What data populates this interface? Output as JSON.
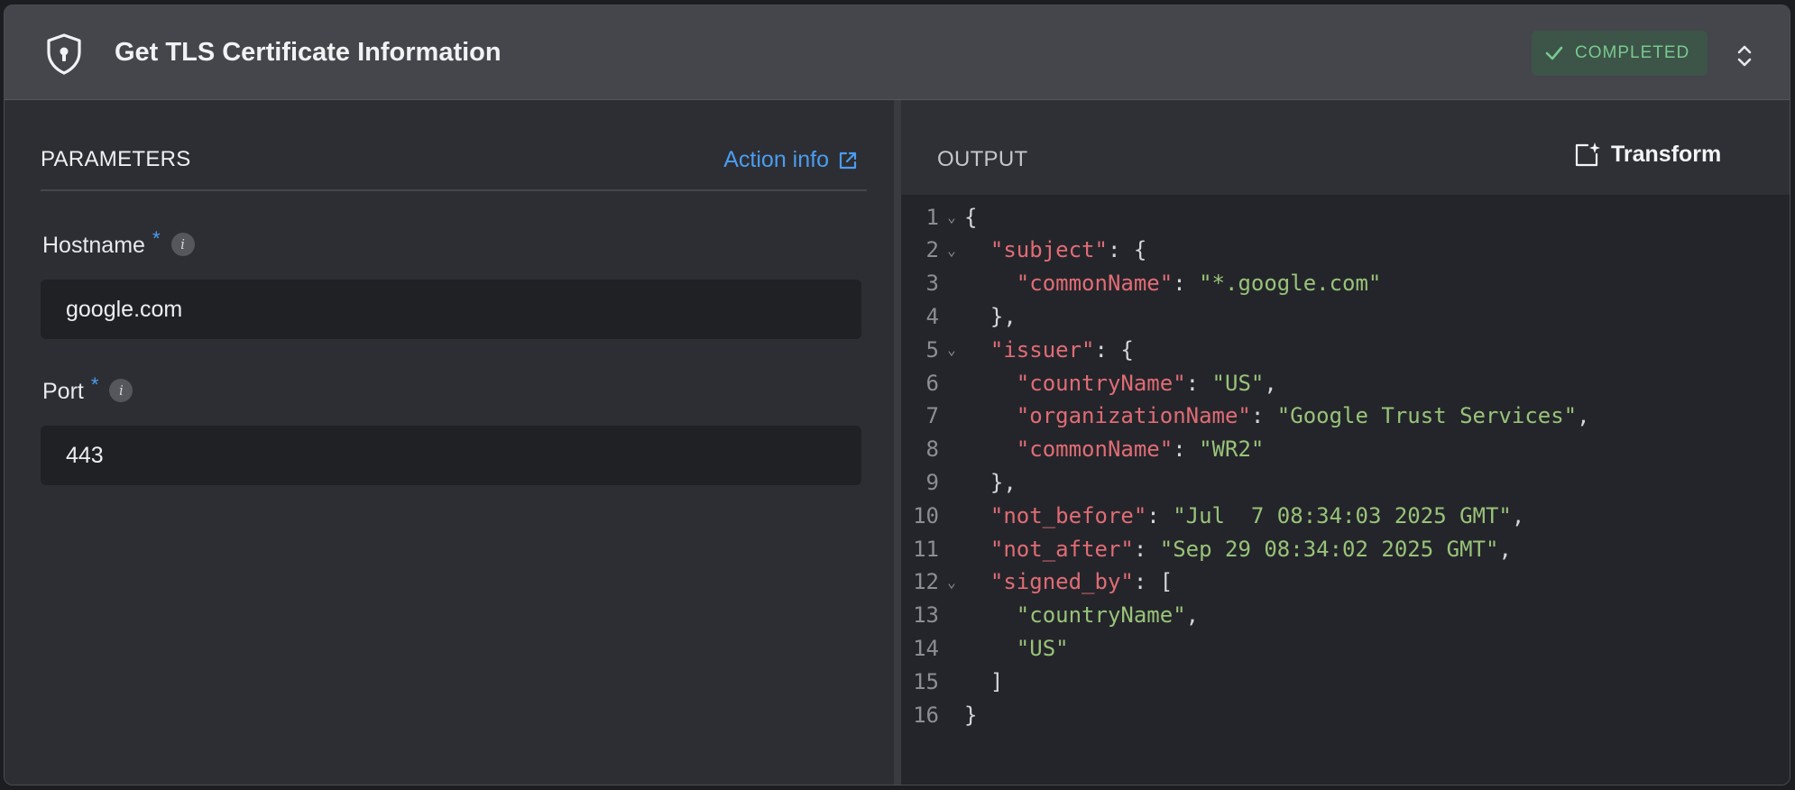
{
  "header": {
    "title": "Get TLS Certificate Information",
    "status": "COMPLETED"
  },
  "parameters": {
    "heading": "PARAMETERS",
    "action_info": "Action info",
    "fields": [
      {
        "label": "Hostname",
        "required_mark": "*",
        "value": "google.com"
      },
      {
        "label": "Port",
        "required_mark": "*",
        "value": "443"
      }
    ]
  },
  "output": {
    "heading": "OUTPUT",
    "transform_label": "Transform",
    "lines": [
      {
        "n": "1",
        "fold": true,
        "indent": "",
        "parts": [
          {
            "t": "c",
            "v": "{"
          }
        ]
      },
      {
        "n": "2",
        "fold": true,
        "indent": "  ",
        "parts": [
          {
            "t": "k",
            "v": "\"subject\""
          },
          {
            "t": "c",
            "v": ": {"
          }
        ]
      },
      {
        "n": "3",
        "fold": false,
        "indent": "    ",
        "parts": [
          {
            "t": "k",
            "v": "\"commonName\""
          },
          {
            "t": "c",
            "v": ": "
          },
          {
            "t": "s",
            "v": "\"*.google.com\""
          }
        ]
      },
      {
        "n": "4",
        "fold": false,
        "indent": "  ",
        "parts": [
          {
            "t": "c",
            "v": "},"
          }
        ]
      },
      {
        "n": "5",
        "fold": true,
        "indent": "  ",
        "parts": [
          {
            "t": "k",
            "v": "\"issuer\""
          },
          {
            "t": "c",
            "v": ": {"
          }
        ]
      },
      {
        "n": "6",
        "fold": false,
        "indent": "    ",
        "parts": [
          {
            "t": "k",
            "v": "\"countryName\""
          },
          {
            "t": "c",
            "v": ": "
          },
          {
            "t": "s",
            "v": "\"US\""
          },
          {
            "t": "c",
            "v": ","
          }
        ]
      },
      {
        "n": "7",
        "fold": false,
        "indent": "    ",
        "parts": [
          {
            "t": "k",
            "v": "\"organizationName\""
          },
          {
            "t": "c",
            "v": ": "
          },
          {
            "t": "s",
            "v": "\"Google Trust Services\""
          },
          {
            "t": "c",
            "v": ","
          }
        ]
      },
      {
        "n": "8",
        "fold": false,
        "indent": "    ",
        "parts": [
          {
            "t": "k",
            "v": "\"commonName\""
          },
          {
            "t": "c",
            "v": ": "
          },
          {
            "t": "s",
            "v": "\"WR2\""
          }
        ]
      },
      {
        "n": "9",
        "fold": false,
        "indent": "  ",
        "parts": [
          {
            "t": "c",
            "v": "},"
          }
        ]
      },
      {
        "n": "10",
        "fold": false,
        "indent": "  ",
        "parts": [
          {
            "t": "k",
            "v": "\"not_before\""
          },
          {
            "t": "c",
            "v": ": "
          },
          {
            "t": "s",
            "v": "\"Jul  7 08:34:03 2025 GMT\""
          },
          {
            "t": "c",
            "v": ","
          }
        ]
      },
      {
        "n": "11",
        "fold": false,
        "indent": "  ",
        "parts": [
          {
            "t": "k",
            "v": "\"not_after\""
          },
          {
            "t": "c",
            "v": ": "
          },
          {
            "t": "s",
            "v": "\"Sep 29 08:34:02 2025 GMT\""
          },
          {
            "t": "c",
            "v": ","
          }
        ]
      },
      {
        "n": "12",
        "fold": true,
        "indent": "  ",
        "parts": [
          {
            "t": "k",
            "v": "\"signed_by\""
          },
          {
            "t": "c",
            "v": ": ["
          }
        ]
      },
      {
        "n": "13",
        "fold": false,
        "indent": "    ",
        "parts": [
          {
            "t": "s",
            "v": "\"countryName\""
          },
          {
            "t": "c",
            "v": ","
          }
        ]
      },
      {
        "n": "14",
        "fold": false,
        "indent": "    ",
        "parts": [
          {
            "t": "s",
            "v": "\"US\""
          }
        ]
      },
      {
        "n": "15",
        "fold": false,
        "indent": "  ",
        "parts": [
          {
            "t": "c",
            "v": "]"
          }
        ]
      },
      {
        "n": "16",
        "fold": false,
        "indent": "",
        "parts": [
          {
            "t": "c",
            "v": "}"
          }
        ]
      }
    ]
  },
  "colors": {
    "accent": "#4a9df0",
    "success": "#79c98f",
    "json_key": "#e06c75",
    "json_string": "#98c379"
  }
}
